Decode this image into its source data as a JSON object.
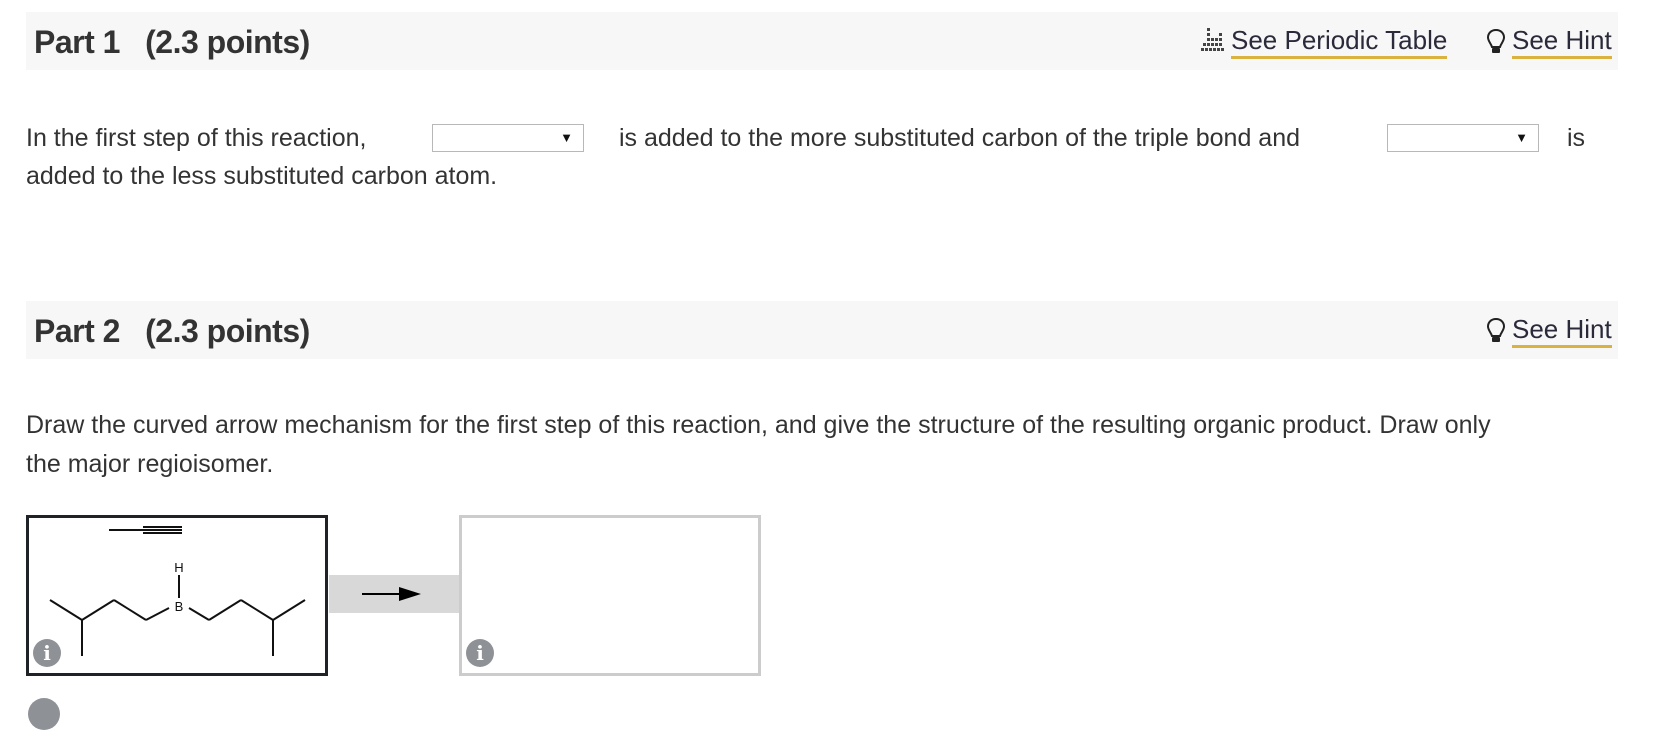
{
  "part1": {
    "title": "Part 1",
    "points": "(2.3 points)",
    "periodic_table_link": "See Periodic Table",
    "hint_link": "See Hint",
    "sentence": {
      "seg1": "In the first step of this reaction,",
      "seg2": "is added to the more substituted carbon of the triple bond and",
      "seg3": "is",
      "seg4": "added to the less substituted carbon atom."
    },
    "dropdown1": {
      "selected": ""
    },
    "dropdown2": {
      "selected": ""
    }
  },
  "part2": {
    "title": "Part 2",
    "points": "(2.3 points)",
    "hint_link": "See Hint",
    "instruction_line1": "Draw the curved arrow mechanism for the first step of this reaction, and give the structure of the resulting organic product. Draw only",
    "instruction_line2": "the major regioisomer.",
    "reactant": {
      "description": "propyne + diisoamylborane (HB with two 3-methylbutyl groups)",
      "atom_labels": {
        "hydrogen": "H",
        "boron": "B"
      }
    },
    "info_icon_glyph": "i",
    "accent_color": "#d9b240"
  }
}
